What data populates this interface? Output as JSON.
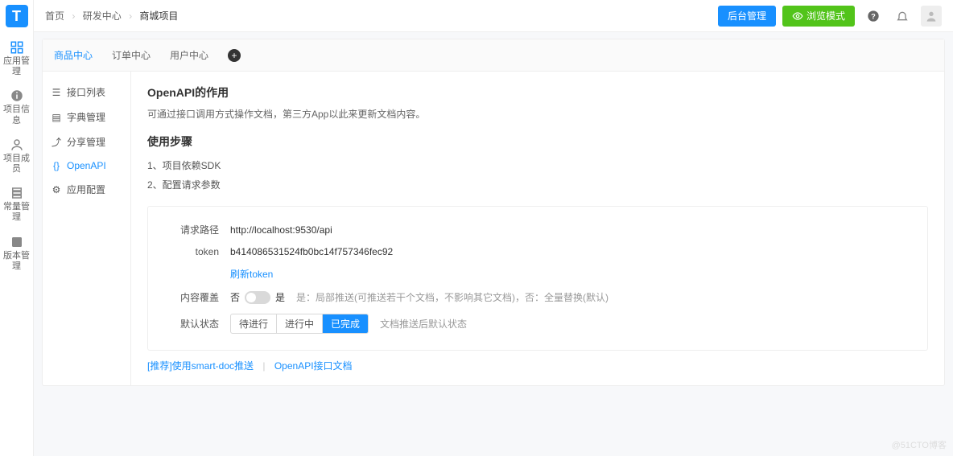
{
  "logo_letter": "T",
  "nav": [
    {
      "id": "apps",
      "label": "应用管理"
    },
    {
      "id": "info",
      "label": "项目信息"
    },
    {
      "id": "members",
      "label": "项目成员"
    },
    {
      "id": "const",
      "label": "常量管理"
    },
    {
      "id": "version",
      "label": "版本管理"
    }
  ],
  "breadcrumb": {
    "home": "首页",
    "center": "研发中心",
    "project": "商城项目"
  },
  "header": {
    "admin_btn": "后台管理",
    "preview_btn": "浏览模式"
  },
  "tabs": {
    "items": [
      {
        "label": "商品中心",
        "active": true
      },
      {
        "label": "订单中心",
        "active": false
      },
      {
        "label": "用户中心",
        "active": false
      }
    ],
    "add": "+"
  },
  "sidebar": {
    "items": [
      {
        "id": "api-list",
        "label": "接口列表"
      },
      {
        "id": "dict",
        "label": "字典管理"
      },
      {
        "id": "share",
        "label": "分享管理"
      },
      {
        "id": "openapi",
        "label": "OpenAPI",
        "active": true
      },
      {
        "id": "appcfg",
        "label": "应用配置"
      }
    ]
  },
  "page": {
    "title1": "OpenAPI的作用",
    "desc": "可通过接口调用方式操作文档，第三方App以此来更新文档内容。",
    "title2": "使用步骤",
    "steps": [
      "1、项目依赖SDK",
      "2、配置请求参数"
    ],
    "form": {
      "path_label": "请求路径",
      "path_value": "http://localhost:9530/api",
      "token_label": "token",
      "token_value": "b414086531524fb0bc14f757346fec92",
      "refresh": "刷新token",
      "cover_label": "内容覆盖",
      "cover_no": "否",
      "cover_yes": "是",
      "cover_hint": "是：局部推送(可推送若干个文档，不影响其它文档)，否：全量替换(默认)",
      "status_label": "默认状态",
      "status_opts": [
        "待进行",
        "进行中",
        "已完成"
      ],
      "status_selected": 2,
      "status_hint": "文档推送后默认状态"
    },
    "footer": {
      "rec": "[推荐]使用smart-doc推送",
      "doc": "OpenAPI接口文档"
    }
  },
  "watermark": "@51CTO博客"
}
